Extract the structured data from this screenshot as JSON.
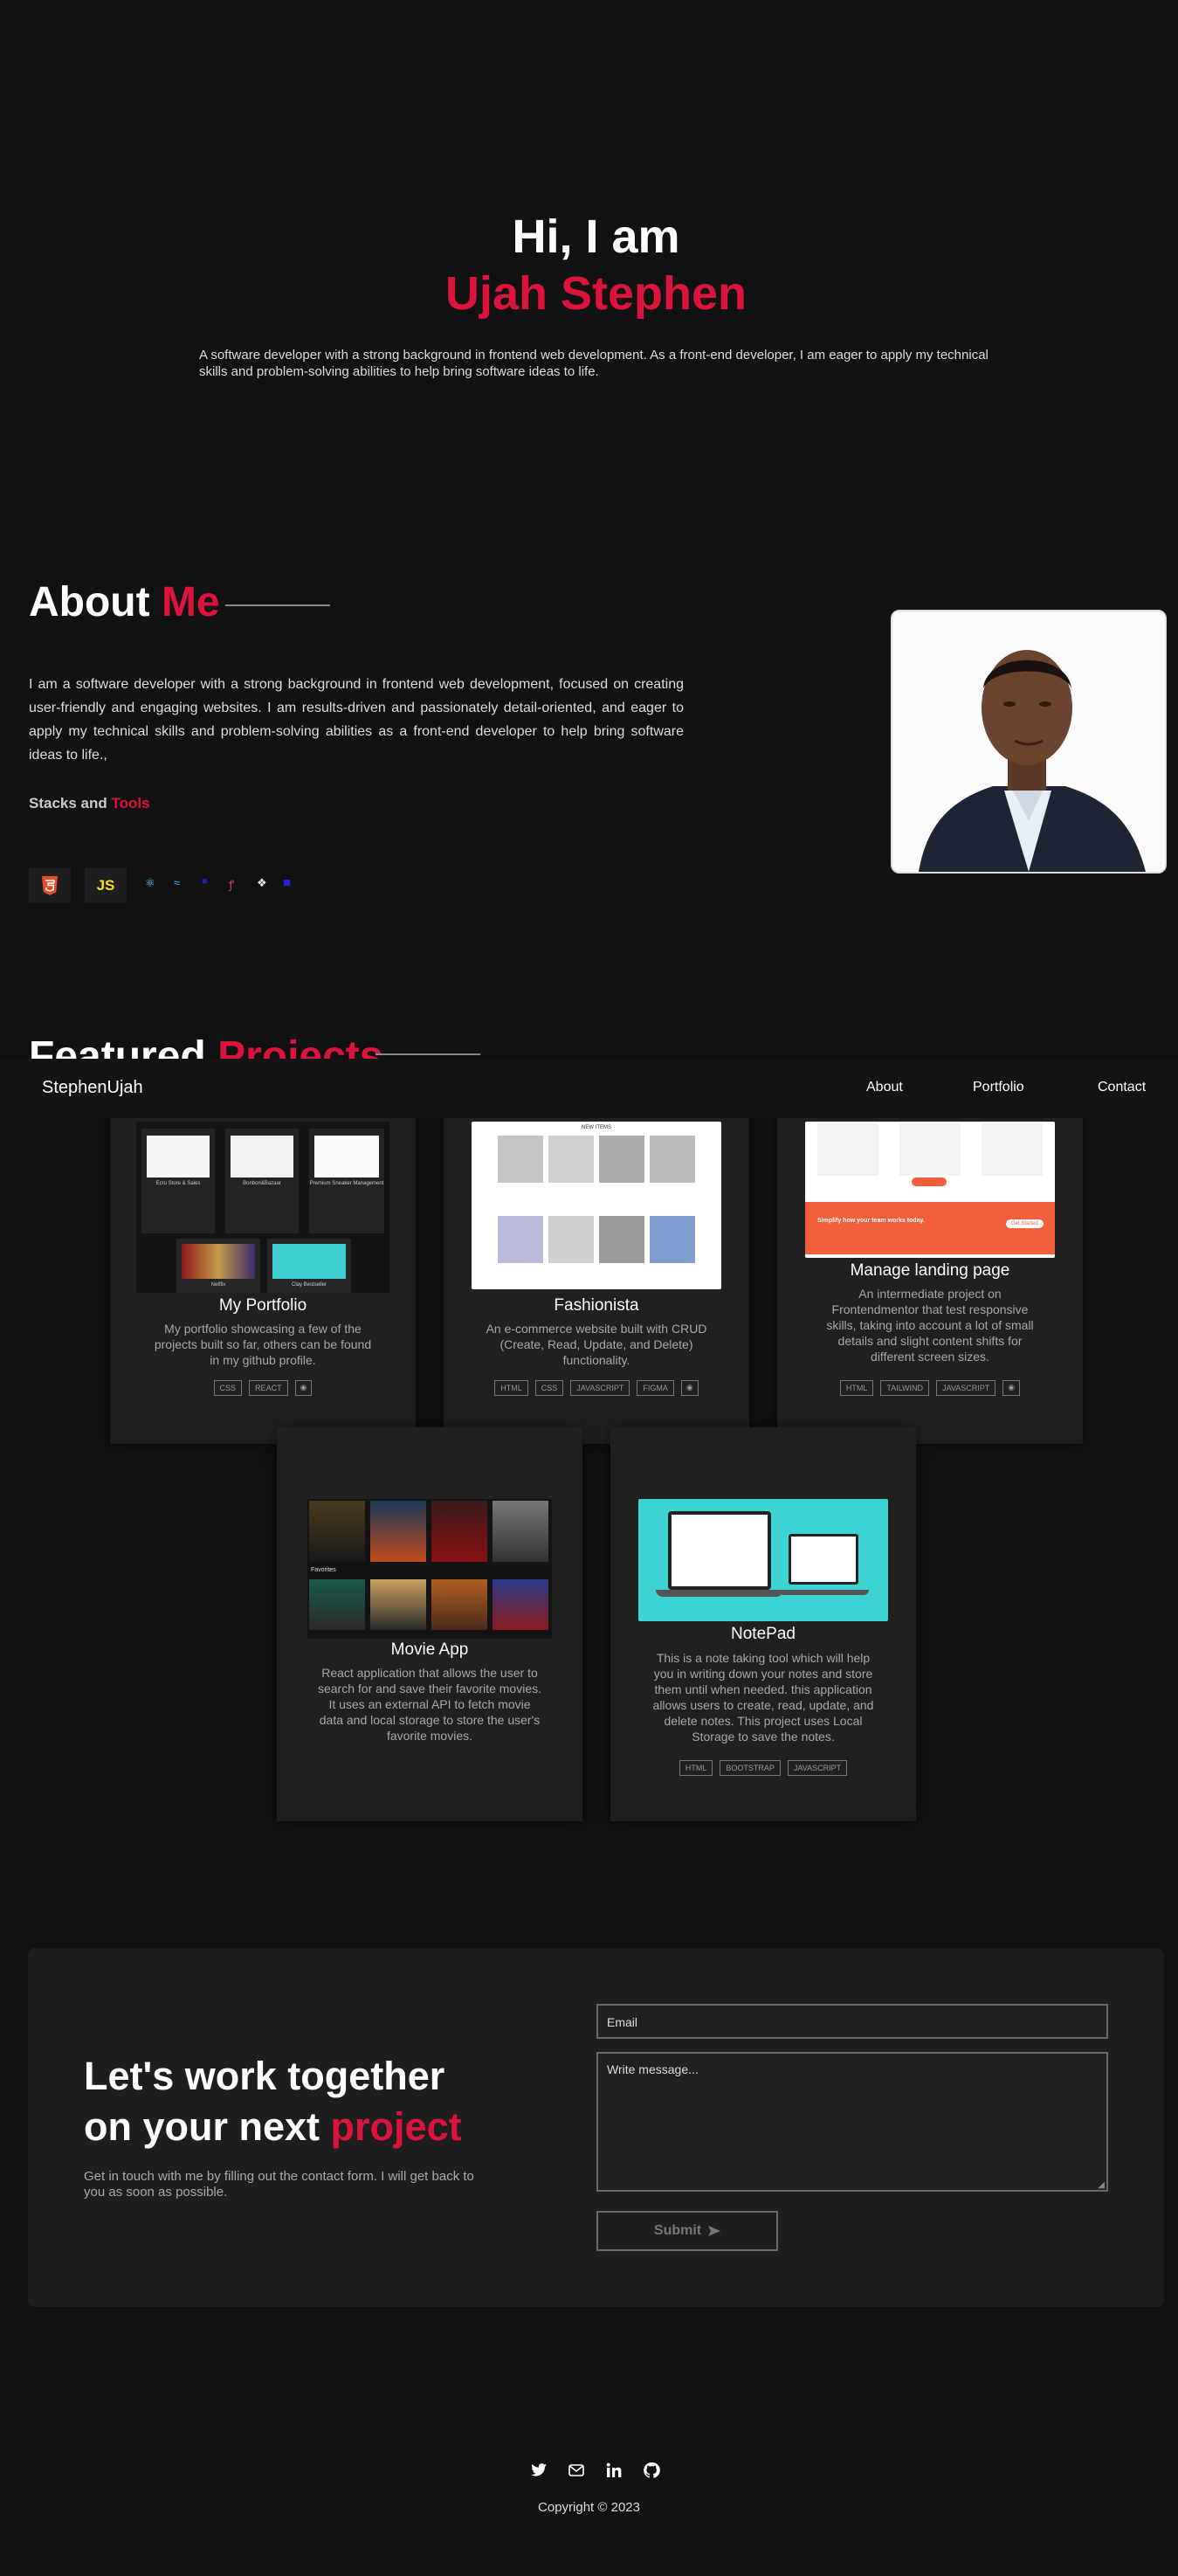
{
  "hero": {
    "greeting": "Hi, I am",
    "name": "Ujah Stephen",
    "description": "A software developer with a strong background in frontend web development. As a front-end developer, I am eager to apply my technical skills and problem-solving abilities to help bring software ideas to life."
  },
  "about": {
    "title_white": "About",
    "title_red": "Me",
    "text": "I am a software developer with a strong background in frontend web development, focused on creating user-friendly and engaging websites. I am results-driven and passionately detail-oriented, and eager to apply my technical skills and problem-solving abilities as a front-end developer to help bring software ideas to life.,",
    "stacks_white": "Stacks and",
    "stacks_red": "Tools",
    "tools": [
      {
        "icon": "html5-icon",
        "label": ""
      },
      {
        "icon": "javascript-icon",
        "label": "JS"
      },
      {
        "icon": "react-icon",
        "glyph": "⚛"
      },
      {
        "icon": "tailwind-icon",
        "glyph": "≈"
      },
      {
        "icon": "typescript-icon",
        "glyph": "■"
      },
      {
        "icon": "sass-icon",
        "glyph": "ꝭ"
      },
      {
        "icon": "figma-icon",
        "glyph": "❖"
      },
      {
        "icon": "bootstrap-icon",
        "glyph": "■"
      }
    ]
  },
  "featured": {
    "title_white": "Featured",
    "title_red": "Projects"
  },
  "nav": {
    "brand": "StephenUjah",
    "links": [
      "About",
      "Portfolio",
      "Contact"
    ]
  },
  "projects": [
    {
      "title": "My Portfolio",
      "description": "My portfolio showcasing a few of the projects built so far, others can be found in my github profile.",
      "tags": [
        "CSS",
        "REACT"
      ]
    },
    {
      "title": "Fashionista",
      "description": "An e-commerce website built with CRUD (Create, Read, Update, and Delete) functionality.",
      "tags": [
        "HTML",
        "CSS",
        "JAVASCRIPT",
        "FIGMA"
      ]
    },
    {
      "title": "Manage landing page",
      "description": "An intermediate project on Frontendmentor that test responsive skills, taking into account a lot of small details and slight content shifts for different screen sizes.",
      "tags": [
        "HTML",
        "TAILWIND",
        "JAVASCRIPT"
      ]
    },
    {
      "title": "Movie App",
      "description": "React application that allows the user to search for and save their favorite movies. It uses an external API to fetch movie data and local storage to store the user's favorite movies.",
      "tags": []
    },
    {
      "title": "NotePad",
      "description": "This is a note taking tool which will help you in writing down your notes and store them until when needed. this application allows users to create, read, update, and delete notes. This project uses Local Storage to save the notes.",
      "tags": [
        "HTML",
        "BOOTSTRAP",
        "JAVASCRIPT"
      ]
    }
  ],
  "thumbs": {
    "portfolio_captions": [
      "Ecru Store & Sales",
      "Bonbon&Bazaar",
      "Premium Sneaker Management",
      "Netflix",
      "Clay Bestseller"
    ],
    "fashion_header": "NEW ITEMS",
    "manage_banner": "Simplify how your team works today.",
    "manage_button": "Get Started",
    "movie_favorites": "Favorites"
  },
  "contact": {
    "line1": "Let's work together",
    "line2_white": "on your next",
    "line2_red": "project",
    "subtext": "Get in touch with me by filling out the contact form. I will get back to you as soon as possible.",
    "email_placeholder": "Email",
    "message_placeholder": "Write message...",
    "submit": "Submit"
  },
  "footer": {
    "icons": [
      "twitter-icon",
      "mail-icon",
      "linkedin-icon",
      "github-icon"
    ],
    "copyright": "Copyright © 2023"
  },
  "colors": {
    "accent": "#dc143c",
    "background": "#121212",
    "card": "#202020"
  }
}
